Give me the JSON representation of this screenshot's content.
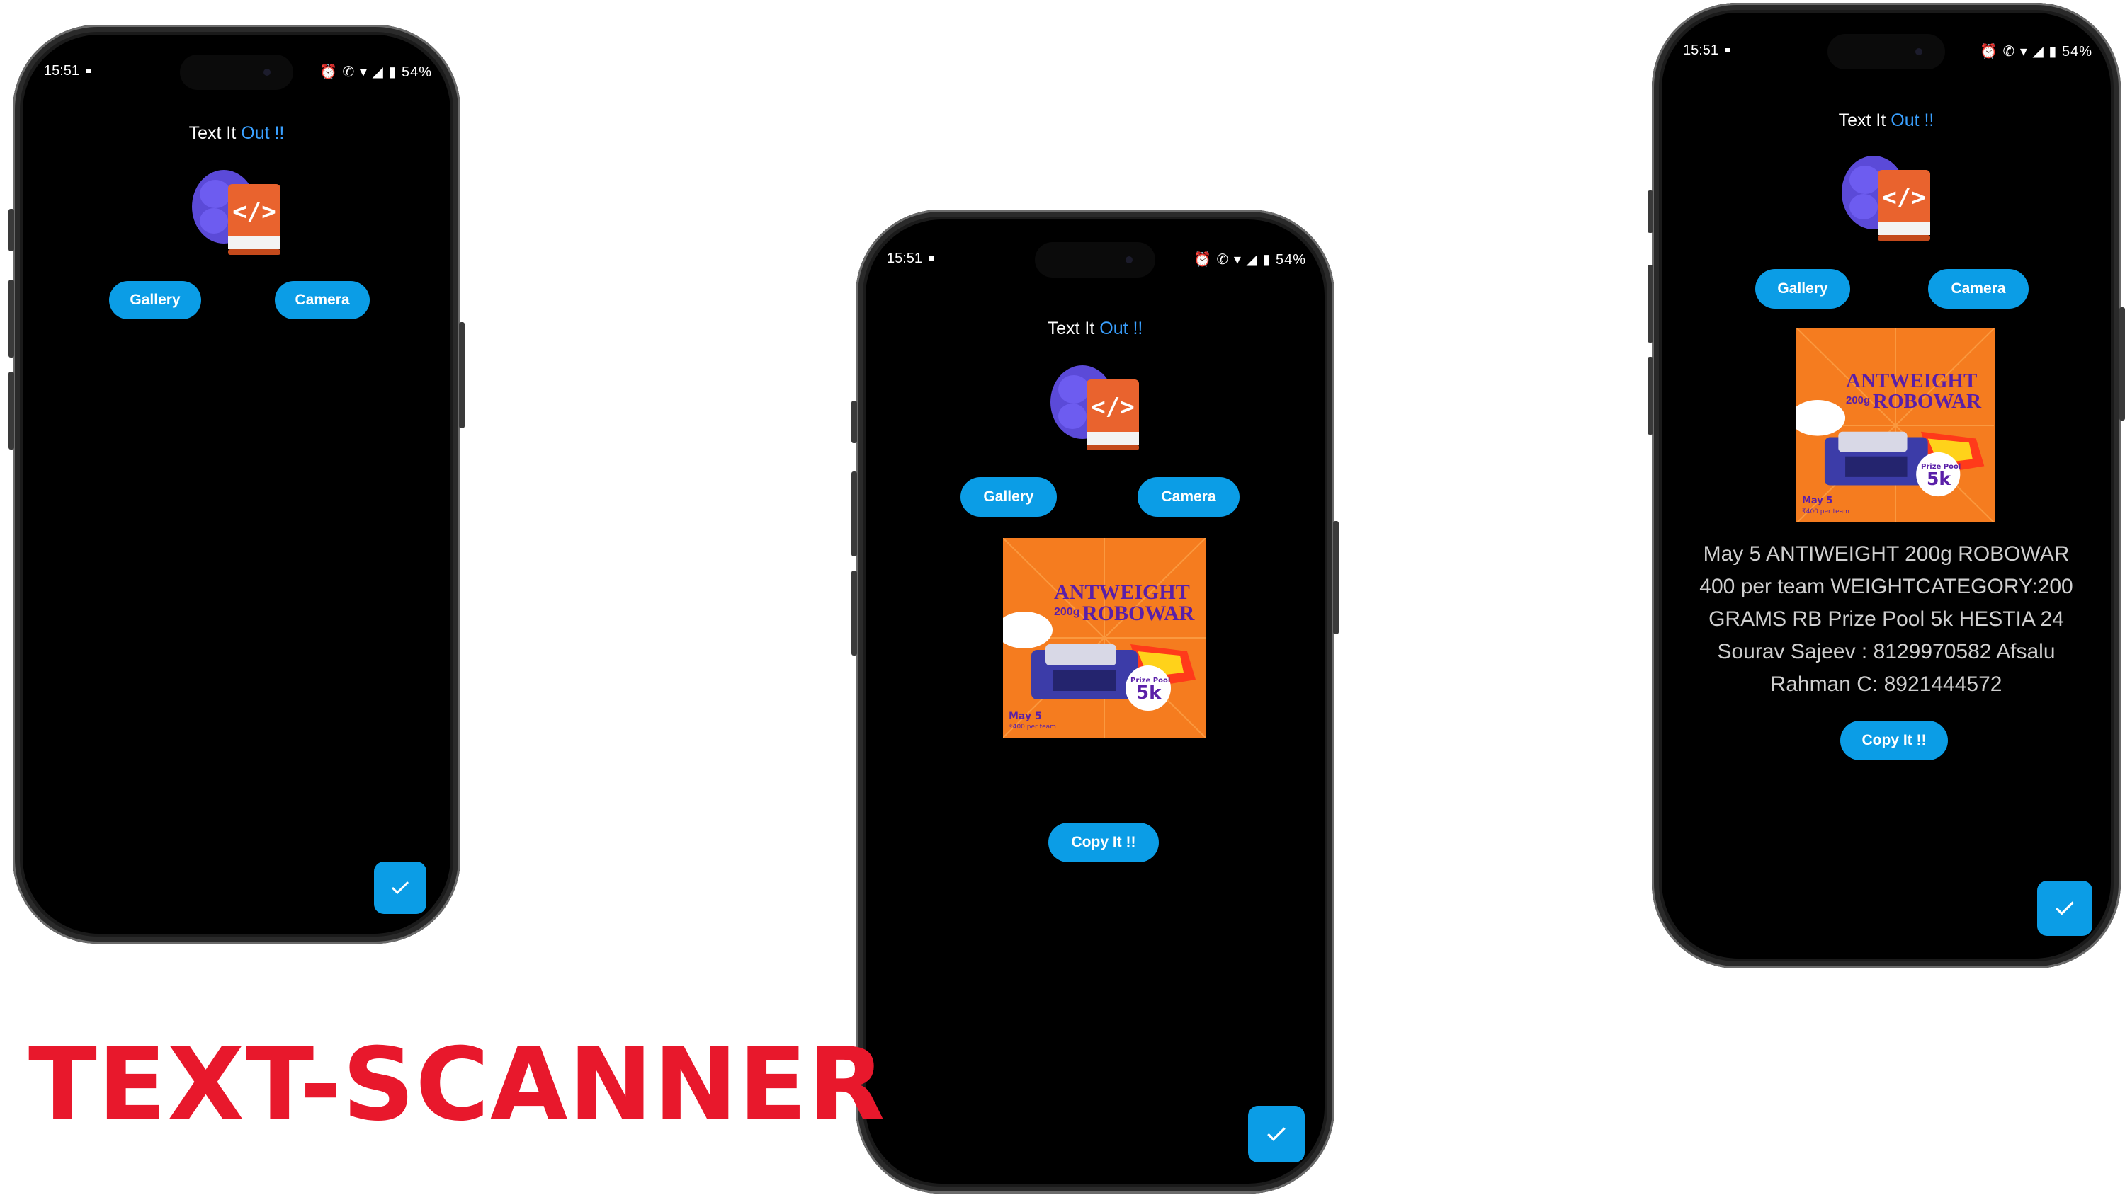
{
  "headline": "TEXT-SCANNER",
  "status": {
    "time": "15:51",
    "icons": "⏰ ✆ ▾ ◢ ▮",
    "battery": "54%"
  },
  "app": {
    "title_prefix": "Text It ",
    "title_accent": "Out !!",
    "accent_color": "#3aa0ff"
  },
  "buttons": {
    "gallery": "Gallery",
    "camera": "Camera",
    "copy": "Copy It !!"
  },
  "fab": {
    "icon": "check-icon"
  },
  "poster": {
    "title_line1": "ANTWEIGHT",
    "title_weight": "200g",
    "title_line2": "ROBOWAR",
    "prize_label": "Prize Pool",
    "prize_value": "5k",
    "date": "May 5",
    "fee": "₹400 per team"
  },
  "ocr_result": "May 5 ANTIWEIGHT 200g ROBOWAR 400 per team WEIGHTCATEGORY:200 GRAMS RB Prize Pool 5k HESTIA 24 Sourav Sajeev : 8129970582 Afsalu Rahman C: 8921444572",
  "colors": {
    "button": "#0b9de6",
    "headline": "#e8182c",
    "poster_bg": "#f57c1f",
    "poster_title": "#5a1fa8"
  }
}
